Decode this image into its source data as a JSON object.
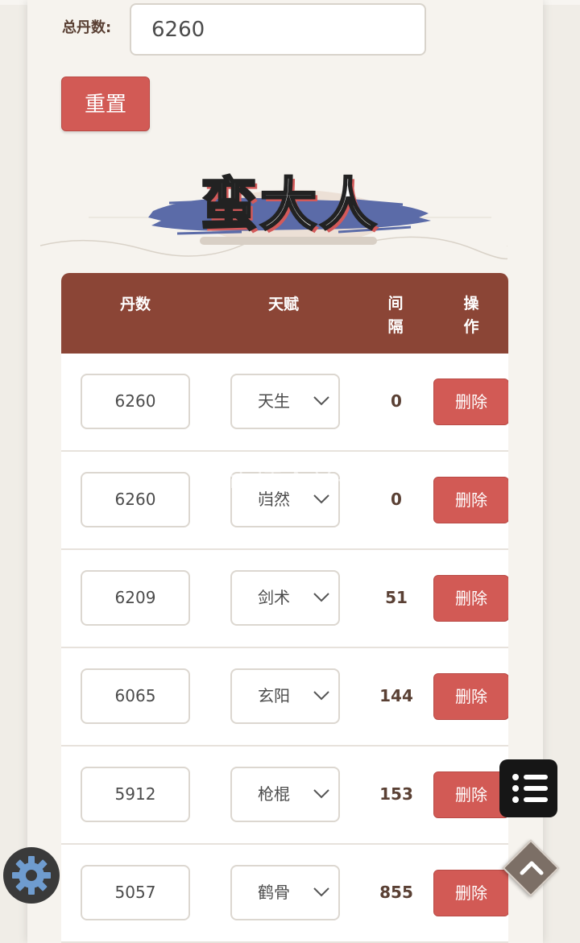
{
  "form": {
    "total_label": "总丹数:",
    "total_value": "6260",
    "reset_label": "重置"
  },
  "title": "蛮大人",
  "table": {
    "headers": {
      "dan": "丹数",
      "talent": "天赋",
      "interval": "间隔",
      "action": "操作"
    },
    "rows": [
      {
        "dan": "6260",
        "talent": "天生",
        "interval": "0",
        "action": "删除"
      },
      {
        "dan": "6260",
        "talent": "岿然",
        "interval": "0",
        "action": "删除"
      },
      {
        "dan": "6209",
        "talent": "剑术",
        "interval": "51",
        "action": "删除"
      },
      {
        "dan": "6065",
        "talent": "玄阳",
        "interval": "144",
        "action": "删除"
      },
      {
        "dan": "5912",
        "talent": "枪棍",
        "interval": "153",
        "action": "删除"
      },
      {
        "dan": "5057",
        "talent": "鹤骨",
        "interval": "855",
        "action": "删除"
      }
    ]
  },
  "watermark": "点击插入文字",
  "icons": {
    "menu": "list-icon",
    "settings": "gear-icon",
    "scroll_top": "chevron-up-icon",
    "dropdown": "chevron-down-icon"
  },
  "colors": {
    "accent_red": "#d25a55",
    "header_brown": "#8b4536",
    "title_stroke_blue": "#5b6ba8"
  }
}
